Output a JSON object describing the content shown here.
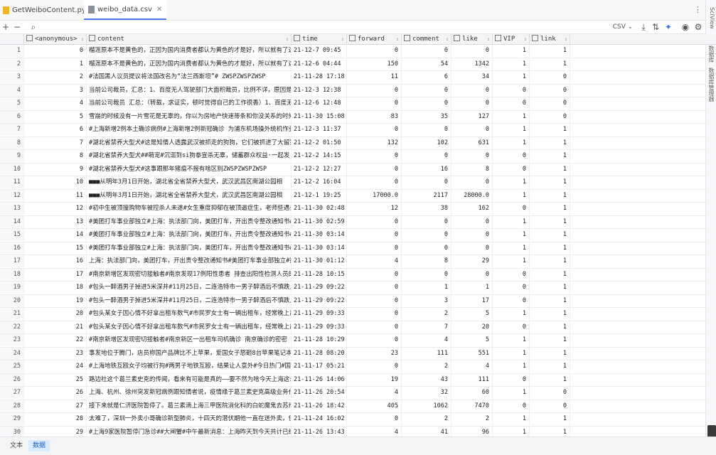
{
  "tabs": [
    {
      "label": "GetWeiboContent.py",
      "color": "#f0b429",
      "active": false
    },
    {
      "label": "weibo_data.csv",
      "color": "#8a8f99",
      "active": true
    }
  ],
  "toolbar": {
    "format": "CSV ⌄"
  },
  "side_labels": [
    "SciView",
    "数据库",
    "数据库管理器"
  ],
  "columns": [
    "<anonymous>",
    "content",
    "time",
    "forward",
    "comment",
    "like",
    "VIP",
    "link"
  ],
  "rows": [
    [
      "1",
      "0",
      "榴莲原本不是黄色的，正因为国内消费者都认为黄色的才是好，所以就有了这",
      "21-12-7 09:45",
      "0",
      "0",
      "0",
      "1",
      "1"
    ],
    [
      "2",
      "1",
      "榴莲原本不是黄色的，正因为国内消费者都认为黄色的才是好，所以就有了这",
      "21-12-6 04:44",
      "150",
      "54",
      "1342",
      "1",
      "1"
    ],
    [
      "3",
      "2",
      "#法国黑人议员提议将法国改名为“法兰西斯坦”#  ZWSPZWSPZWSP",
      "21-11-28 17:18",
      "11",
      "6",
      "34",
      "1",
      "0"
    ],
    [
      "4",
      "3",
      "当前公司裁员，汇总：1、百度无人驾驶部门大面积裁员，比例不详，原因是",
      "21-12-3 12:38",
      "0",
      "0",
      "0",
      "0",
      "0"
    ],
    [
      "5",
      "4",
      "当前公司裁员 汇总：（转载，求证实，顿时觉得自己的工作很香）1、百度无",
      "21-12-6 12:48",
      "0",
      "0",
      "0",
      "0",
      "0"
    ],
    [
      "6",
      "5",
      "雪崩的时候没有一片雪花是无辜的，你以为房地产快速蒂条和你没关系的时候",
      "21-11-30 15:08",
      "83",
      "35",
      "127",
      "1",
      "0"
    ],
    [
      "7",
      "6",
      "#上海新增2例本土确诊病例#上海新增2例新冠确诊  为浦东机场操外统机作业",
      "21-12-3 11:37",
      "0",
      "0",
      "0",
      "1",
      "1"
    ],
    [
      "8",
      "7",
      "#湖北省禁养大型犬#这是知情人透露武汉被抓走的狗狗，它们被抓进了大留狗",
      "21-12-2 01:50",
      "132",
      "102",
      "631",
      "1",
      "1"
    ],
    [
      "9",
      "8",
      "#湖北省禁养大型犬##萌宠#沉溺到si狗拳宣杀无辜，储蓄群众权益·一起发",
      "21-12-2 14:15",
      "0",
      "0",
      "0",
      "0",
      "1"
    ],
    [
      "10",
      "9",
      "#湖北省禁养大型犬#这事跟那年猪瘟不报有啥区别ZWSPZWSPZWSP",
      "21-12-2 12:27",
      "0",
      "16",
      "8",
      "0",
      "1"
    ],
    [
      "11",
      "10",
      "■■■从明年3月1日开始，湖北省全省禁养大型犬，武汉武昌区南湖公园相",
      "21-12-2 16:04",
      "0",
      "0",
      "0",
      "1",
      "1"
    ],
    [
      "12",
      "11",
      "■■■从明年3月1日开始，湖北省全省禁养大型犬，武汉武昌区南湖公园相",
      "21-12-1 19:25",
      "17000.0",
      "2117",
      "28000.0",
      "1",
      "1"
    ],
    [
      "13",
      "12",
      "#初中生被顶撞购物车被控杀人未遂#女生重度抑郁在被顶逼症生，老师些遇亲",
      "21-11-30 02:48",
      "12",
      "38",
      "162",
      "0",
      "1"
    ],
    [
      "14",
      "13",
      "#美团打车事业部独立#上海：执法部门向，美团打车，开出责令整改通知书#",
      "21-11-30 02:59",
      "0",
      "0",
      "0",
      "1",
      "1"
    ],
    [
      "15",
      "14",
      "#美团打车事业部独立#上海：执法部门向，美团打车，开出责令整改通知书#",
      "21-11-30 03:14",
      "0",
      "0",
      "0",
      "1",
      "1"
    ],
    [
      "16",
      "15",
      "#美团打车事业部独立#上海：执法部门向，美团打车，开出责令整改通知书#",
      "21-11-30 03:14",
      "0",
      "0",
      "0",
      "1",
      "1"
    ],
    [
      "17",
      "16",
      "上海：执法部门向，美团打车，开出责令整改通知书#美团打车事业部独立#播",
      "21-11-30 01:12",
      "4",
      "8",
      "29",
      "1",
      "1"
    ],
    [
      "18",
      "17",
      "#南京新增区发现密切接触者#南京发现17例阳性患者  排查出阳性检测人员的",
      "21-11-28 10:15",
      "0",
      "0",
      "0",
      "0",
      "1"
    ],
    [
      "19",
      "18",
      "#包头一醉酒男子掉进5米深井#11月25日，二连浩特市一男子醉酒后不慎跌入",
      "21-11-29 09:22",
      "0",
      "1",
      "1",
      "0",
      "1"
    ],
    [
      "20",
      "19",
      "#包头一醉酒男子掉进5米深井#11月25日，二连浩特市一男子醉酒后不慎跌入",
      "21-11-29 09:22",
      "0",
      "3",
      "17",
      "0",
      "1"
    ],
    [
      "21",
      "20",
      "#包头某女子因心情不好拿出租车数气#市民罗女士有一辆出租车，经常晚上出",
      "21-11-29 09:33",
      "0",
      "2",
      "5",
      "1",
      "1"
    ],
    [
      "22",
      "21",
      "#包头某女子因心情不好拿出租车数气#市民罗女士有一辆出租车，经常晚上出",
      "21-11-29 09:33",
      "0",
      "7",
      "20",
      "0",
      "1"
    ],
    [
      "23",
      "22",
      "#南京新增区发现密切接触者#南京新区一出租车司机确诊  南京确诊的密密",
      "21-11-28 10:29",
      "0",
      "4",
      "5",
      "1",
      "1"
    ],
    [
      "24",
      "23",
      "事发地位于腾门，店员称国产品牌比不上苹果，爱国女子怒砸8台苹果笔记本",
      "21-11-28 08:20",
      "23",
      "111",
      "551",
      "1",
      "1"
    ],
    [
      "25",
      "24",
      "#上海地铁互殴女子均被行拘#两男子地铁互殴，结果让人意外#今日热门#国国",
      "21-11-17 05:21",
      "0",
      "2",
      "4",
      "1",
      "1"
    ],
    [
      "26",
      "25",
      "路边社这个葛兰素史克的传闻，看来有可能是真的——要不然为啥今天上海这么",
      "21-11-26 14:06",
      "19",
      "43",
      "111",
      "0",
      "1"
    ],
    [
      "27",
      "26",
      "上海、杭州、徐州突发新冠病例跟知情者说，疫情缘于葛兰素史克高级业务代",
      "21-11-26 20:54",
      "4",
      "32",
      "60",
      "1",
      "0"
    ],
    [
      "28",
      "27",
      "接下来就是仁济医院暂停了。葛兰素滴上海三甲医院消化科的白蛇魔鬼去苏州",
      "21-11-26 18:42",
      "405",
      "1062",
      "7470",
      "0",
      "0"
    ],
    [
      "29",
      "28",
      "太难了，深圳一外卖小哥确诊新型肺炎，十四天的潜伏期他一直在送外卖，但",
      "21-11-24 16:02",
      "0",
      "2",
      "2",
      "1",
      "1"
    ],
    [
      "30",
      "29",
      "#上海9家医院暂停门急诊##大闸蟹#中午最新消息：上海昨天到今天共计已经",
      "21-11-26 13:43",
      "4",
      "41",
      "96",
      "1",
      "1"
    ],
    [
      "31",
      "30",
      "疫情就是命令！！  ZWSPZWSPZWSP",
      "21-11-26 11:52",
      "0",
      "0",
      "0",
      "0",
      "0"
    ],
    [
      "32",
      "31",
      "听说是一个医药代表请这家医院的医生吃饭，然后医药代表确诊了，医生，医",
      "21-11-26 13:57",
      "0",
      "3",
      "1",
      "0",
      "1"
    ]
  ],
  "bottom_tabs": [
    {
      "label": "文本",
      "active": false
    },
    {
      "label": "数据",
      "active": true
    }
  ]
}
